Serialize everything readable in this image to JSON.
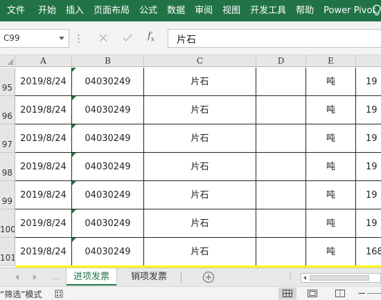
{
  "ribbon": {
    "tabs": [
      "文件",
      "开始",
      "插入",
      "页面布局",
      "公式",
      "数据",
      "审阅",
      "视图",
      "开发工具",
      "帮助",
      "Power Pivot"
    ]
  },
  "formula_bar": {
    "name_box": "C99",
    "fx": "f",
    "fx_sub": "x",
    "content": "片石"
  },
  "grid": {
    "columns": [
      "A",
      "B",
      "C",
      "D",
      "E",
      ""
    ],
    "rows": [
      {
        "num": "95",
        "a": "2019/8/24",
        "b": "04030249",
        "c": "片石",
        "d": "",
        "e": "吨",
        "f": "19"
      },
      {
        "num": "96",
        "a": "2019/8/24",
        "b": "04030249",
        "c": "片石",
        "d": "",
        "e": "吨",
        "f": "19"
      },
      {
        "num": "97",
        "a": "2019/8/24",
        "b": "04030249",
        "c": "片石",
        "d": "",
        "e": "吨",
        "f": "19"
      },
      {
        "num": "98",
        "a": "2019/8/24",
        "b": "04030249",
        "c": "片石",
        "d": "",
        "e": "吨",
        "f": "19"
      },
      {
        "num": "99",
        "a": "2019/8/24",
        "b": "04030249",
        "c": "片石",
        "d": "",
        "e": "吨",
        "f": "19"
      },
      {
        "num": "100",
        "a": "2019/8/24",
        "b": "04030249",
        "c": "片石",
        "d": "",
        "e": "吨",
        "f": "19"
      },
      {
        "num": "101",
        "a": "2019/8/24",
        "b": "04030249",
        "c": "片石",
        "d": "",
        "e": "吨",
        "f": "168"
      }
    ]
  },
  "sheets": {
    "dots_left": "...",
    "active": "进项发票",
    "inactive": "销项发票",
    "dots_right": "⋮"
  },
  "status": {
    "text": "“筛选”模式"
  },
  "colors": {
    "ribbon": "#217346",
    "indicator": "#1e7c3a",
    "highlight_row": "#ffff00"
  }
}
